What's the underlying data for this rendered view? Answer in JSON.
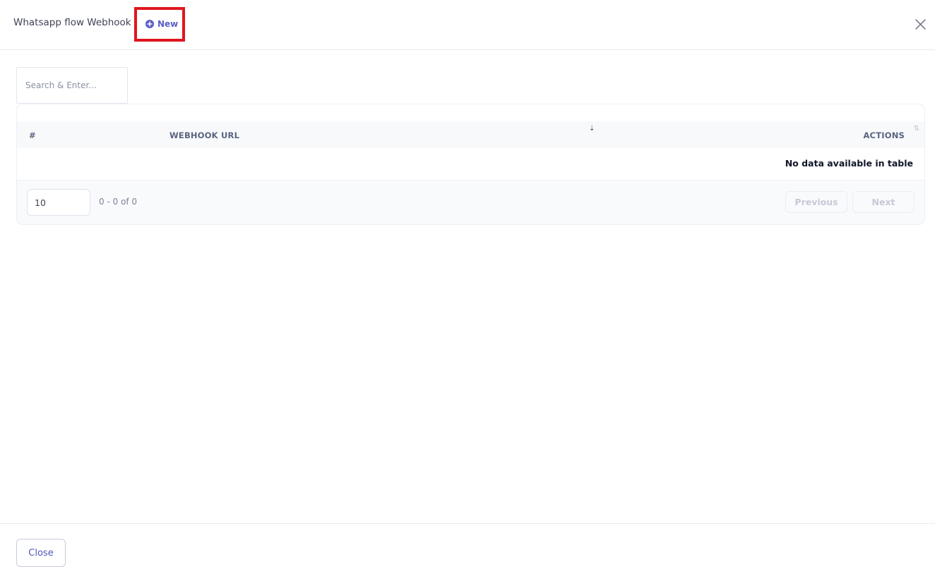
{
  "header": {
    "title": "Whatsapp flow Webhook",
    "new_label": "New",
    "new_icon": "plus-circle-icon",
    "close_icon": "close-icon"
  },
  "search": {
    "placeholder": "Search & Enter..."
  },
  "table": {
    "columns": [
      "#",
      "WEBHOOK URL",
      "ACTIONS"
    ],
    "sort_icons": {
      "webhook_url": "sort-desc-icon",
      "actions": "sort-both-icon"
    },
    "rows": [],
    "empty_text": "No data available in table"
  },
  "pagination": {
    "page_size": "10",
    "range": "0 - 0 of 0",
    "previous_label": "Previous",
    "next_label": "Next"
  },
  "footer": {
    "close_label": "Close"
  },
  "colors": {
    "accent": "#5b5fc7",
    "highlight_border": "#e0161e",
    "muted_text": "#7e8299"
  }
}
